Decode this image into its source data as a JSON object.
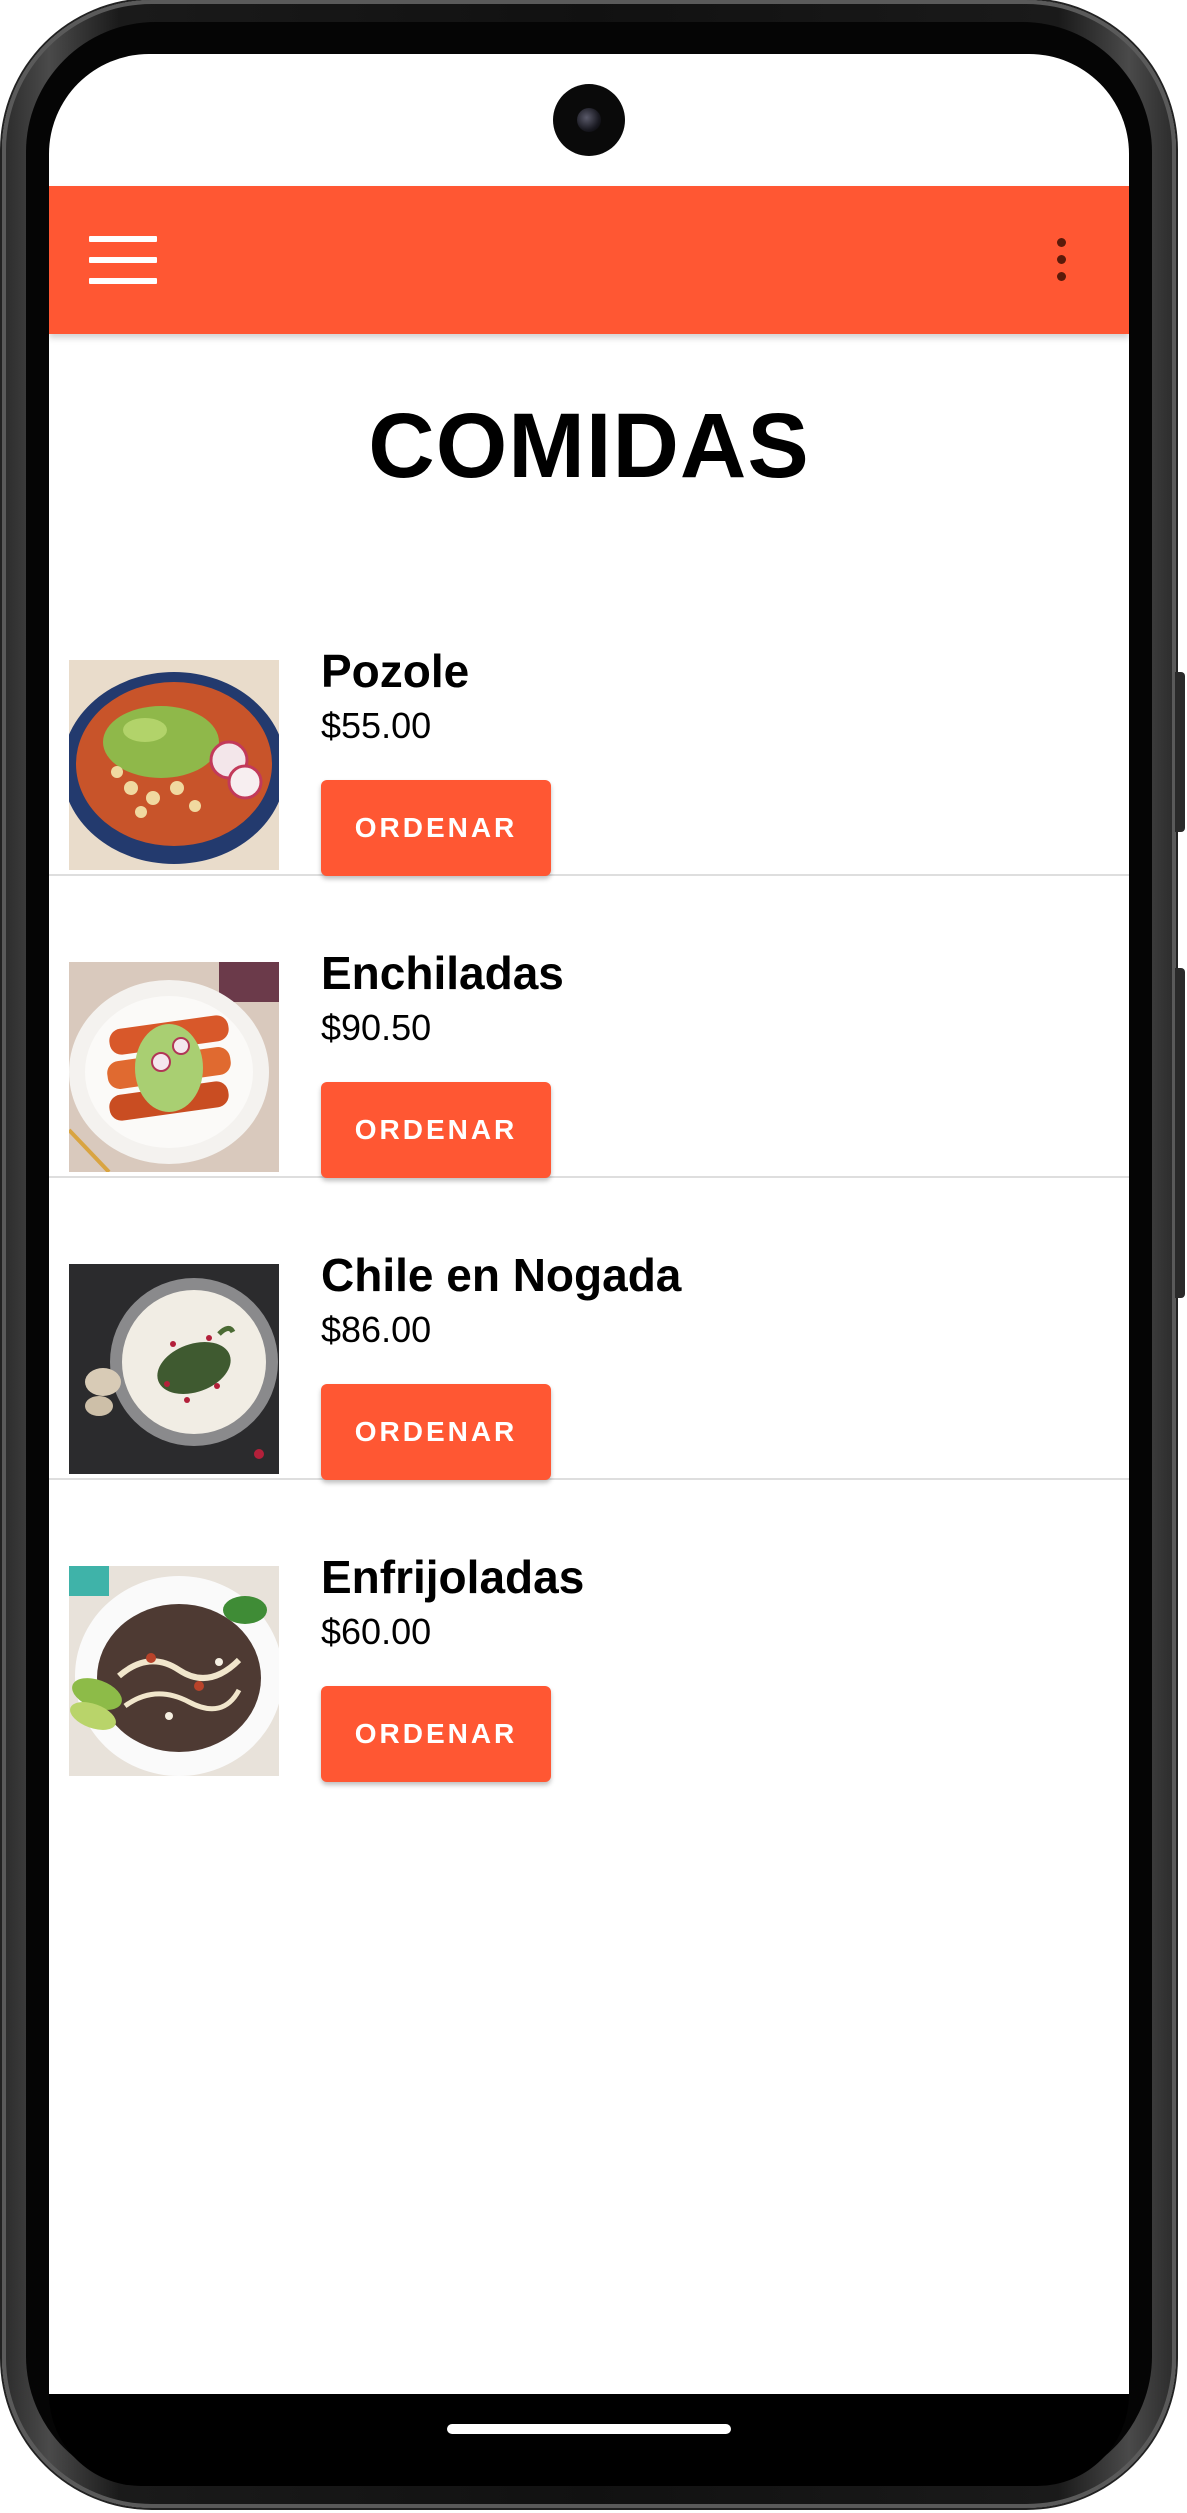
{
  "app": {
    "title": "COMIDAS",
    "accent_color": "#FF5733",
    "menu_icon": "hamburger-menu-icon",
    "overflow_icon": "more-vert-icon"
  },
  "items": [
    {
      "name": "Pozole",
      "price": "$55.00",
      "button": "ORDENAR",
      "image": "pozole-bowl-photo"
    },
    {
      "name": "Enchiladas",
      "price": "$90.50",
      "button": "ORDENAR",
      "image": "enchiladas-plate-photo"
    },
    {
      "name": "Chile en Nogada",
      "price": "$86.00",
      "button": "ORDENAR",
      "image": "chile-en-nogada-photo"
    },
    {
      "name": "Enfrijoladas",
      "price": "$60.00",
      "button": "ORDENAR",
      "image": "enfrijoladas-plate-photo"
    }
  ]
}
